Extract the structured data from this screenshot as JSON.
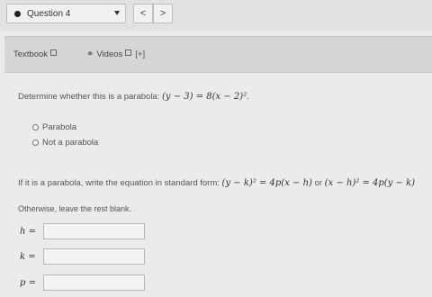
{
  "header": {
    "question_label": "Question 4",
    "prev_symbol": "<",
    "next_symbol": ">"
  },
  "toolbar": {
    "textbook_label": "Textbook",
    "videos_label": "Videos",
    "videos_plus": "[+]"
  },
  "question": {
    "prompt": "Determine whether this is a parabola:",
    "equation": "(y − 3) = 8(x − 2)²",
    "end_punct": "."
  },
  "options": [
    {
      "label": "Parabola",
      "selected": false
    },
    {
      "label": "Not a parabola",
      "selected": false
    }
  ],
  "instructions": {
    "text": "If it is a parabola, write the equation in standard form:",
    "form1": "(y − k)² = 4p(x − h)",
    "or_text": "or",
    "form2": "(x − h)² = 4p(y − k)"
  },
  "otherwise_text": "Otherwise, leave the rest blank.",
  "fields": [
    {
      "label": "h =",
      "value": ""
    },
    {
      "label": "k =",
      "value": ""
    },
    {
      "label": "p =",
      "value": ""
    }
  ]
}
